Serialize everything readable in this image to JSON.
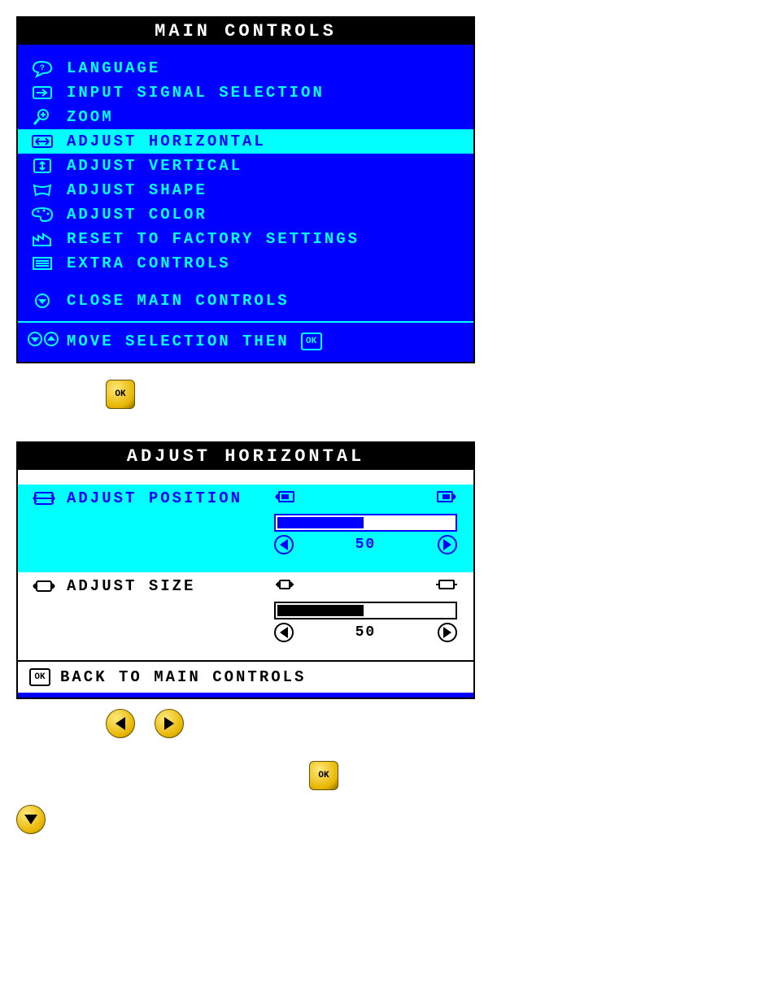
{
  "main": {
    "title": "MAIN CONTROLS",
    "items": [
      {
        "icon": "speech-icon",
        "label": "LANGUAGE"
      },
      {
        "icon": "input-icon",
        "label": "INPUT SIGNAL SELECTION"
      },
      {
        "icon": "zoom-icon",
        "label": "ZOOM"
      },
      {
        "icon": "horiz-icon",
        "label": "ADJUST HORIZONTAL"
      },
      {
        "icon": "vert-icon",
        "label": "ADJUST VERTICAL"
      },
      {
        "icon": "shape-icon",
        "label": "ADJUST SHAPE"
      },
      {
        "icon": "palette-icon",
        "label": "ADJUST COLOR"
      },
      {
        "icon": "factory-icon",
        "label": "RESET TO FACTORY SETTINGS"
      },
      {
        "icon": "extra-icon",
        "label": "EXTRA CONTROLS"
      }
    ],
    "selected_index": 3,
    "close_label": "CLOSE MAIN CONTROLS",
    "hint_label": "MOVE SELECTION THEN"
  },
  "adjust": {
    "title": "ADJUST HORIZONTAL",
    "rows": [
      {
        "icon": "pos-icon",
        "label": "ADJUST POSITION",
        "value": "50"
      },
      {
        "icon": "size-icon",
        "label": "ADJUST SIZE",
        "value": "50"
      }
    ],
    "selected_index": 0,
    "back_label": "BACK TO MAIN CONTROLS"
  }
}
